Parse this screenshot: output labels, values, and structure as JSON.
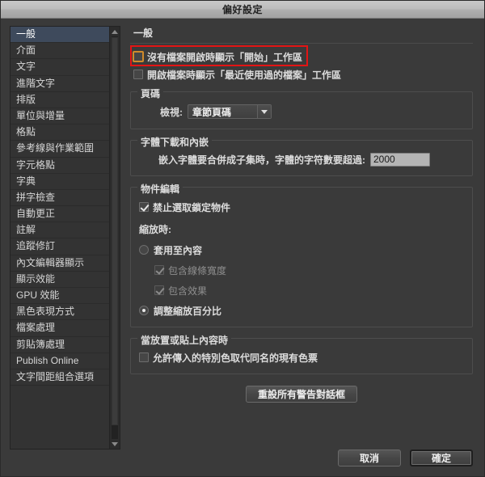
{
  "window": {
    "title": "偏好設定"
  },
  "sidebar": {
    "items": [
      {
        "label": "一般",
        "selected": true
      },
      {
        "label": "介面",
        "selected": false
      },
      {
        "label": "文字",
        "selected": false
      },
      {
        "label": "進階文字",
        "selected": false
      },
      {
        "label": "排版",
        "selected": false
      },
      {
        "label": "單位與增量",
        "selected": false
      },
      {
        "label": "格點",
        "selected": false
      },
      {
        "label": "參考線與作業範圍",
        "selected": false
      },
      {
        "label": "字元格點",
        "selected": false
      },
      {
        "label": "字典",
        "selected": false
      },
      {
        "label": "拼字檢查",
        "selected": false
      },
      {
        "label": "自動更正",
        "selected": false
      },
      {
        "label": "註解",
        "selected": false
      },
      {
        "label": "追蹤修訂",
        "selected": false
      },
      {
        "label": "內文編輯器顯示",
        "selected": false
      },
      {
        "label": "顯示效能",
        "selected": false
      },
      {
        "label": "GPU 效能",
        "selected": false
      },
      {
        "label": "黑色表現方式",
        "selected": false
      },
      {
        "label": "檔案處理",
        "selected": false
      },
      {
        "label": "剪貼簿處理",
        "selected": false
      },
      {
        "label": "Publish Online",
        "selected": false
      },
      {
        "label": "文字間距組合選項",
        "selected": false
      }
    ],
    "scrollbar": {
      "up_arrow": "scroll-up-arrow",
      "down_arrow": "scroll-down-arrow"
    }
  },
  "panel": {
    "title": "一般",
    "checkbox_start_workspace": {
      "label": "沒有檔案開啟時顯示「開始」工作區",
      "checked": false,
      "focused": true
    },
    "checkbox_recent_files_workspace": {
      "label": "開啟檔案時顯示「最近使用過的檔案」工作區",
      "checked": false
    },
    "group_page_number": {
      "legend": "頁碼",
      "view_label": "檢視:",
      "view_value": "章節頁碼"
    },
    "group_font_download": {
      "legend": "字體下載和內嵌",
      "subset_label": "嵌入字體要合併成子集時，字體的字符數要超過:",
      "subset_value": "2000"
    },
    "group_object_editing": {
      "legend": "物件編輯",
      "checkbox_lock_objects": {
        "label": "禁止選取鎖定物件",
        "checked": true
      },
      "scaling_label": "縮放時:",
      "radio_apply_to_content": {
        "label": "套用至內容",
        "selected": false
      },
      "checkbox_include_stroke_weight": {
        "label": "包含線條寬度",
        "checked": true,
        "disabled": true
      },
      "checkbox_include_effects": {
        "label": "包含效果",
        "checked": true,
        "disabled": true
      },
      "radio_adjust_scaling_percentage": {
        "label": "調整縮放百分比",
        "selected": true
      }
    },
    "group_place_paste": {
      "legend": "當放置或貼上內容時",
      "checkbox_allow_spot_color": {
        "label": "允許傳入的特別色取代同名的現有色票",
        "checked": false
      }
    },
    "reset_button_label": "重設所有警告對話框"
  },
  "footer": {
    "cancel_label": "取消",
    "ok_label": "確定"
  },
  "annotation": {
    "color": "#e31414",
    "target": "checkbox_start_workspace"
  }
}
